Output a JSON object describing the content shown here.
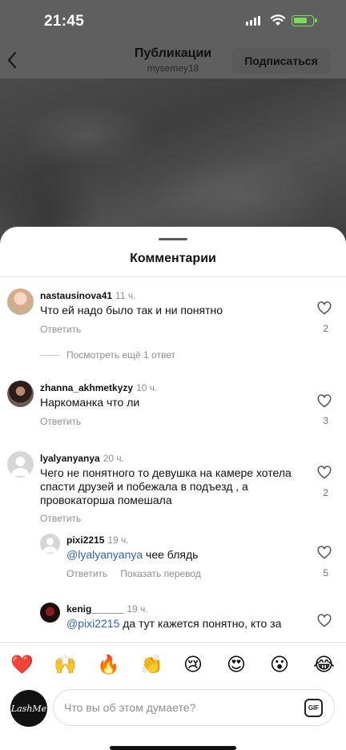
{
  "status_bar": {
    "time": "21:45"
  },
  "header": {
    "title": "Публикации",
    "subtitle": "mysemey18",
    "follow_label": "Подписаться"
  },
  "sheet": {
    "title": "Комментарии"
  },
  "comments": [
    {
      "username": "nastausinova41",
      "time": "11 ч.",
      "text": "Что ей надо было так и ни понятно",
      "reply_label": "Ответить",
      "likes": "2",
      "more_replies": "Посмотреть ещё 1 ответ"
    },
    {
      "username": "zhanna_akhmetkyzy",
      "time": "10 ч.",
      "text": "Наркоманка что ли",
      "reply_label": "Ответить",
      "likes": "3"
    },
    {
      "username": "lyalyanyanya",
      "time": "20 ч.",
      "text": "Чего не понятного то девушка на камере хотела спасти друзей и побежала в подъезд , а провокаторша помешала",
      "reply_label": "Ответить",
      "likes": "2"
    },
    {
      "username": "pixi2215",
      "time": "19 ч.",
      "mention": "@lyalyanyanya",
      "text": " чее блядь",
      "reply_label": "Ответить",
      "translate_label": "Показать перевод",
      "likes": "5"
    },
    {
      "username": "kenig______",
      "time": "19 ч.",
      "mention": "@pixi2215",
      "text": " да тут кажется понятно, кто за"
    }
  ],
  "emoji_bar": [
    "❤️",
    "🙌",
    "🔥",
    "👏",
    "😢",
    "😍",
    "😮",
    "😂"
  ],
  "composer": {
    "avatar_text": "LashMe",
    "placeholder": "Что вы об этом думаете?",
    "gif_label": "GIF"
  },
  "icons": {
    "back": "chevron-left-icon",
    "heart": "heart-outline-icon",
    "gif": "gif-icon"
  },
  "colors": {
    "mention": "#2f63b8",
    "battery": "#7ed957"
  }
}
